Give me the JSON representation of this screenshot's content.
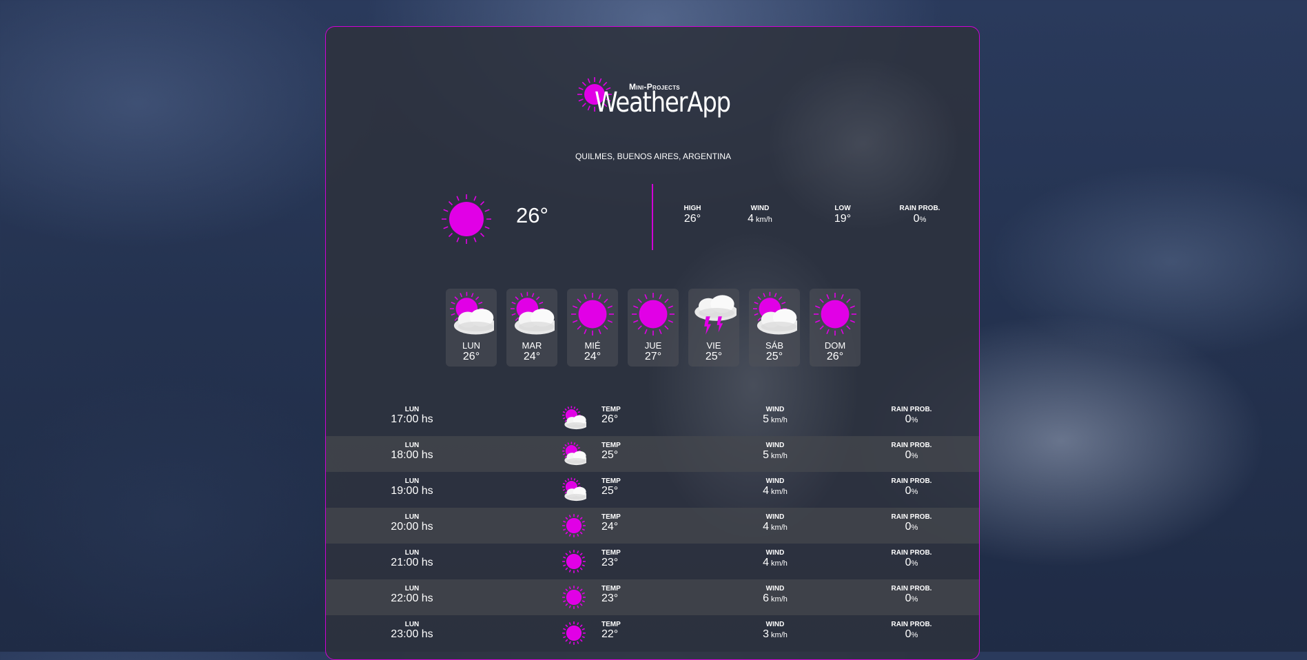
{
  "app": {
    "brand_sub": "Mini-Projects",
    "brand_title": "WeatherApp"
  },
  "location": "QUILMES, BUENOS AIRES, ARGENTINA",
  "current": {
    "icon": "sun-icon",
    "temp": "26°",
    "stats": [
      {
        "label": "HIGH",
        "value": "26°",
        "unit": ""
      },
      {
        "label": "WIND",
        "value": "4",
        "unit": "km/h"
      },
      {
        "label": "LOW",
        "value": "19°",
        "unit": ""
      },
      {
        "label": "RAIN PROB.",
        "value": "0",
        "unit": "%"
      }
    ]
  },
  "daily": [
    {
      "day": "LUN",
      "temp": "26°",
      "icon": "partly-cloudy-icon"
    },
    {
      "day": "MAR",
      "temp": "24°",
      "icon": "partly-cloudy-icon"
    },
    {
      "day": "MIÉ",
      "temp": "24°",
      "icon": "sun-icon"
    },
    {
      "day": "JUE",
      "temp": "27°",
      "icon": "sun-icon"
    },
    {
      "day": "VIE",
      "temp": "25°",
      "icon": "thunderstorm-icon"
    },
    {
      "day": "SÁB",
      "temp": "25°",
      "icon": "partly-cloudy-icon"
    },
    {
      "day": "DOM",
      "temp": "26°",
      "icon": "sun-icon"
    }
  ],
  "hourly_labels": {
    "temp": "TEMP",
    "wind": "WIND",
    "rain": "RAIN PROB.",
    "wind_unit": "km/h",
    "rain_unit": "%"
  },
  "hourly": [
    {
      "day": "LUN",
      "time": "17:00 hs",
      "icon": "partly-cloudy-icon",
      "temp": "26°",
      "wind": "5",
      "rain": "0"
    },
    {
      "day": "LUN",
      "time": "18:00 hs",
      "icon": "partly-cloudy-icon",
      "temp": "25°",
      "wind": "5",
      "rain": "0"
    },
    {
      "day": "LUN",
      "time": "19:00 hs",
      "icon": "partly-cloudy-icon",
      "temp": "25°",
      "wind": "4",
      "rain": "0"
    },
    {
      "day": "LUN",
      "time": "20:00 hs",
      "icon": "sun-icon",
      "temp": "24°",
      "wind": "4",
      "rain": "0"
    },
    {
      "day": "LUN",
      "time": "21:00 hs",
      "icon": "sun-icon",
      "temp": "23°",
      "wind": "4",
      "rain": "0"
    },
    {
      "day": "LUN",
      "time": "22:00 hs",
      "icon": "sun-icon",
      "temp": "23°",
      "wind": "6",
      "rain": "0"
    },
    {
      "day": "LUN",
      "time": "23:00 hs",
      "icon": "sun-icon",
      "temp": "22°",
      "wind": "3",
      "rain": "0"
    }
  ],
  "colors": {
    "accent": "#e100e6",
    "card_border": "#d100d6"
  }
}
